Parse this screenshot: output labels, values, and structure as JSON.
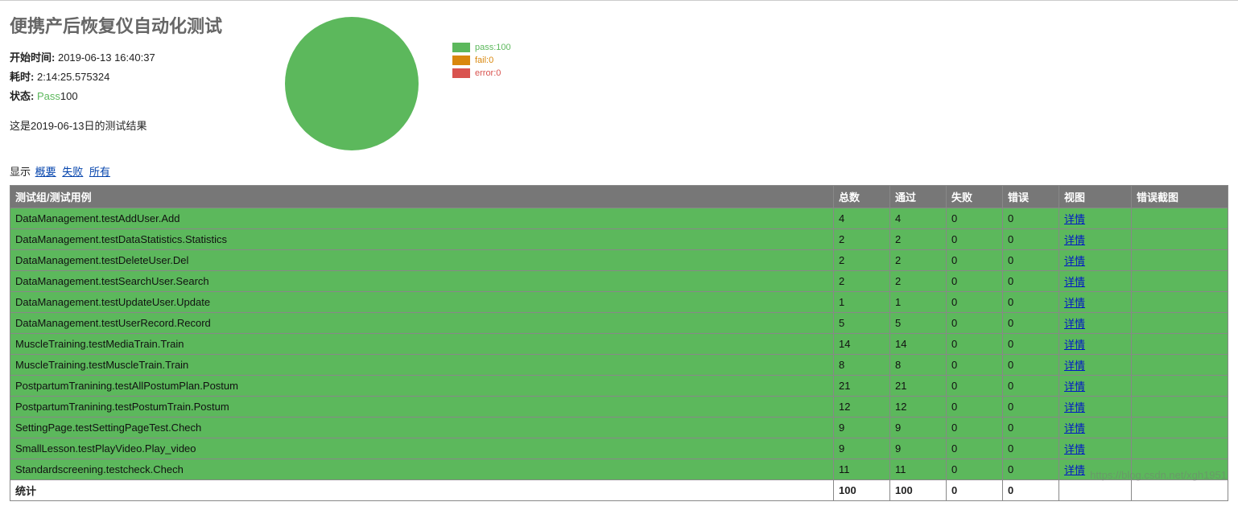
{
  "title": "便携产后恢复仪自动化测试",
  "meta": {
    "start_label": "开始时间:",
    "start_value": "2019-06-13 16:40:37",
    "duration_label": "耗时:",
    "duration_value": "2:14:25.575324",
    "status_label": "状态:",
    "status_value_pass": "Pass",
    "status_value_num": "100"
  },
  "description": "这是2019-06-13日的测试结果",
  "chart_data": {
    "type": "pie",
    "title": "",
    "categories": [
      "pass",
      "fail",
      "error"
    ],
    "values": [
      100,
      0,
      0
    ],
    "series": [
      {
        "name": "pass",
        "value": 100,
        "color": "#5cb85c"
      },
      {
        "name": "fail",
        "value": 0,
        "color": "#d9870d"
      },
      {
        "name": "error",
        "value": 0,
        "color": "#d9534f"
      }
    ],
    "legend": {
      "pass": "pass:100",
      "fail": "fail:0",
      "error": "error:0"
    }
  },
  "filter": {
    "prefix": "显示",
    "summary": "概要",
    "failed": "失败",
    "all": "所有"
  },
  "table": {
    "headers": {
      "name": "测试组/测试用例",
      "total": "总数",
      "pass": "通过",
      "fail": "失败",
      "error": "错误",
      "view": "视图",
      "screenshot": "错误截图"
    },
    "detail_link": "详情",
    "rows": [
      {
        "name": "DataManagement.testAddUser.Add",
        "total": 4,
        "pass": 4,
        "fail": 0,
        "error": 0
      },
      {
        "name": "DataManagement.testDataStatistics.Statistics",
        "total": 2,
        "pass": 2,
        "fail": 0,
        "error": 0
      },
      {
        "name": "DataManagement.testDeleteUser.Del",
        "total": 2,
        "pass": 2,
        "fail": 0,
        "error": 0
      },
      {
        "name": "DataManagement.testSearchUser.Search",
        "total": 2,
        "pass": 2,
        "fail": 0,
        "error": 0
      },
      {
        "name": "DataManagement.testUpdateUser.Update",
        "total": 1,
        "pass": 1,
        "fail": 0,
        "error": 0
      },
      {
        "name": "DataManagement.testUserRecord.Record",
        "total": 5,
        "pass": 5,
        "fail": 0,
        "error": 0
      },
      {
        "name": "MuscleTraining.testMediaTrain.Train",
        "total": 14,
        "pass": 14,
        "fail": 0,
        "error": 0
      },
      {
        "name": "MuscleTraining.testMuscleTrain.Train",
        "total": 8,
        "pass": 8,
        "fail": 0,
        "error": 0
      },
      {
        "name": "PostpartumTranining.testAllPostumPlan.Postum",
        "total": 21,
        "pass": 21,
        "fail": 0,
        "error": 0
      },
      {
        "name": "PostpartumTranining.testPostumTrain.Postum",
        "total": 12,
        "pass": 12,
        "fail": 0,
        "error": 0
      },
      {
        "name": "SettingPage.testSettingPageTest.Chech",
        "total": 9,
        "pass": 9,
        "fail": 0,
        "error": 0
      },
      {
        "name": "SmallLesson.testPlayVideo.Play_video",
        "total": 9,
        "pass": 9,
        "fail": 0,
        "error": 0
      },
      {
        "name": "Standardscreening.testcheck.Chech",
        "total": 11,
        "pass": 11,
        "fail": 0,
        "error": 0
      }
    ],
    "totals": {
      "label": "统计",
      "total": 100,
      "pass": 100,
      "fail": 0,
      "error": 0
    }
  },
  "watermark": "https://blog.csdn.net/xgh1951"
}
